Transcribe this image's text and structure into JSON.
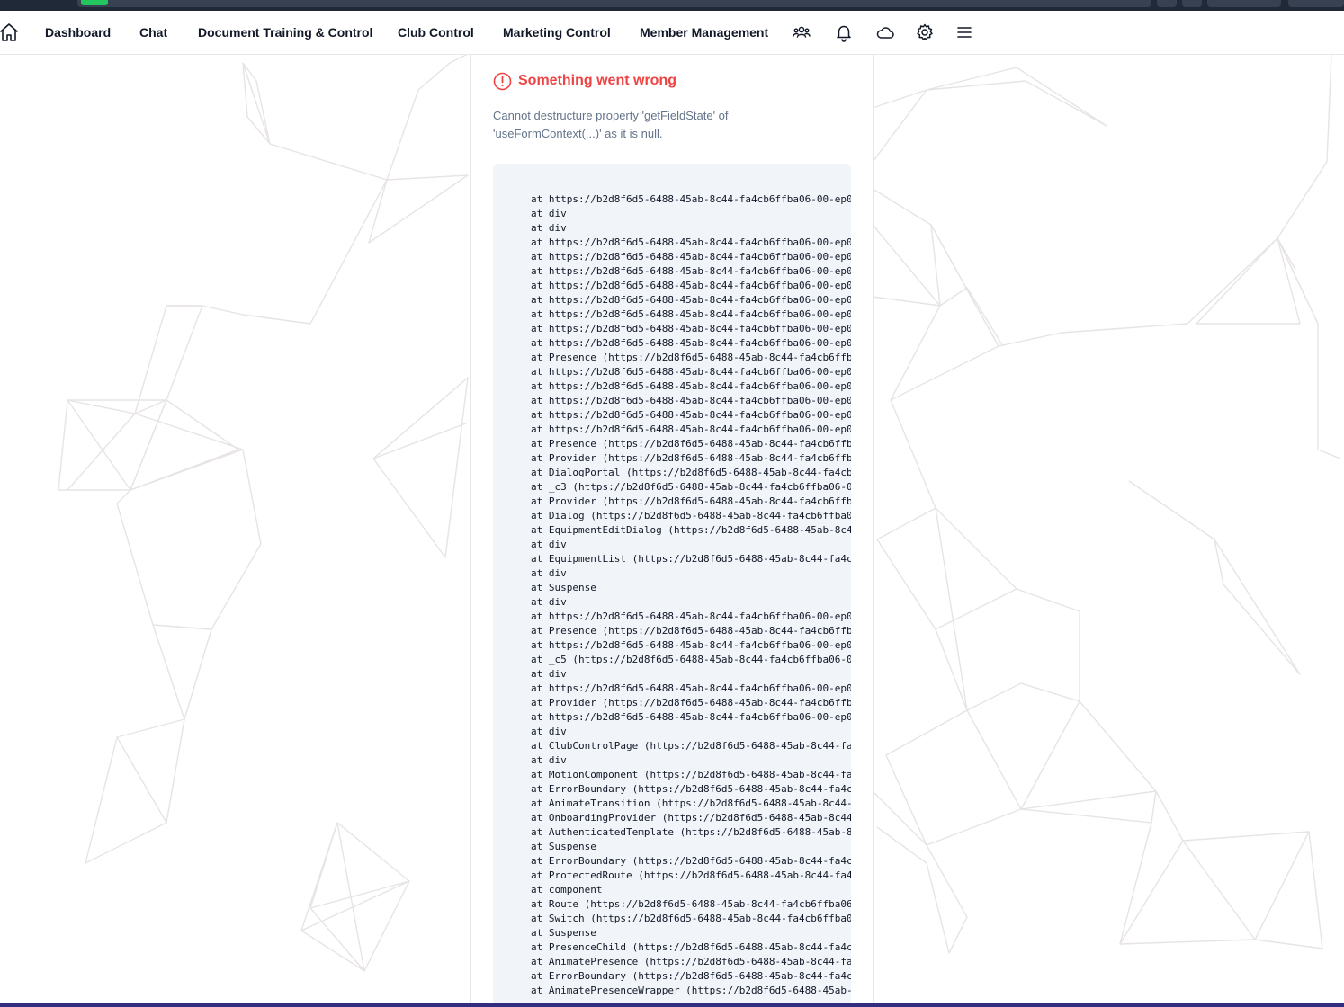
{
  "nav": {
    "links": [
      "Dashboard",
      "Chat",
      "Document Training & Control",
      "Club Control",
      "Marketing Control",
      "Member Management"
    ],
    "icons": [
      "home-icon",
      "users-icon",
      "bell-icon",
      "cloud-icon",
      "gear-icon",
      "menu-icon"
    ]
  },
  "error": {
    "title": "Something went wrong",
    "message": "Cannot destructure property 'getFieldState' of 'useFormContext(...)' as it is null.",
    "stack": [
      "at https://b2d8f6d5-6488-45ab-8c44-fa4cb6ffba06-00-ep0",
      "at div",
      "at div",
      "at https://b2d8f6d5-6488-45ab-8c44-fa4cb6ffba06-00-ep0",
      "at https://b2d8f6d5-6488-45ab-8c44-fa4cb6ffba06-00-ep0",
      "at https://b2d8f6d5-6488-45ab-8c44-fa4cb6ffba06-00-ep0",
      "at https://b2d8f6d5-6488-45ab-8c44-fa4cb6ffba06-00-ep0",
      "at https://b2d8f6d5-6488-45ab-8c44-fa4cb6ffba06-00-ep0",
      "at https://b2d8f6d5-6488-45ab-8c44-fa4cb6ffba06-00-ep0",
      "at https://b2d8f6d5-6488-45ab-8c44-fa4cb6ffba06-00-ep0",
      "at https://b2d8f6d5-6488-45ab-8c44-fa4cb6ffba06-00-ep0",
      "at Presence (https://b2d8f6d5-6488-45ab-8c44-fa4cb6ffb",
      "at https://b2d8f6d5-6488-45ab-8c44-fa4cb6ffba06-00-ep0",
      "at https://b2d8f6d5-6488-45ab-8c44-fa4cb6ffba06-00-ep0",
      "at https://b2d8f6d5-6488-45ab-8c44-fa4cb6ffba06-00-ep0",
      "at https://b2d8f6d5-6488-45ab-8c44-fa4cb6ffba06-00-ep0",
      "at https://b2d8f6d5-6488-45ab-8c44-fa4cb6ffba06-00-ep0",
      "at Presence (https://b2d8f6d5-6488-45ab-8c44-fa4cb6ffb",
      "at Provider (https://b2d8f6d5-6488-45ab-8c44-fa4cb6ffb",
      "at DialogPortal (https://b2d8f6d5-6488-45ab-8c44-fa4cb",
      "at _c3 (https://b2d8f6d5-6488-45ab-8c44-fa4cb6ffba06-0",
      "at Provider (https://b2d8f6d5-6488-45ab-8c44-fa4cb6ffb",
      "at Dialog (https://b2d8f6d5-6488-45ab-8c44-fa4cb6ffba0",
      "at EquipmentEditDialog (https://b2d8f6d5-6488-45ab-8c4",
      "at div",
      "at EquipmentList (https://b2d8f6d5-6488-45ab-8c44-fa4c",
      "at div",
      "at Suspense",
      "at div",
      "at https://b2d8f6d5-6488-45ab-8c44-fa4cb6ffba06-00-ep0",
      "at Presence (https://b2d8f6d5-6488-45ab-8c44-fa4cb6ffb",
      "at https://b2d8f6d5-6488-45ab-8c44-fa4cb6ffba06-00-ep0",
      "at _c5 (https://b2d8f6d5-6488-45ab-8c44-fa4cb6ffba06-0",
      "at div",
      "at https://b2d8f6d5-6488-45ab-8c44-fa4cb6ffba06-00-ep0",
      "at Provider (https://b2d8f6d5-6488-45ab-8c44-fa4cb6ffb",
      "at https://b2d8f6d5-6488-45ab-8c44-fa4cb6ffba06-00-ep0",
      "at div",
      "at ClubControlPage (https://b2d8f6d5-6488-45ab-8c44-fa",
      "at div",
      "at MotionComponent (https://b2d8f6d5-6488-45ab-8c44-fa",
      "at ErrorBoundary (https://b2d8f6d5-6488-45ab-8c44-fa4c",
      "at AnimateTransition (https://b2d8f6d5-6488-45ab-8c44-",
      "at OnboardingProvider (https://b2d8f6d5-6488-45ab-8c44",
      "at AuthenticatedTemplate (https://b2d8f6d5-6488-45ab-8",
      "at Suspense",
      "at ErrorBoundary (https://b2d8f6d5-6488-45ab-8c44-fa4c",
      "at ProtectedRoute (https://b2d8f6d5-6488-45ab-8c44-fa4",
      "at component",
      "at Route (https://b2d8f6d5-6488-45ab-8c44-fa4cb6ffba06",
      "at Switch (https://b2d8f6d5-6488-45ab-8c44-fa4cb6ffba0",
      "at Suspense",
      "at PresenceChild (https://b2d8f6d5-6488-45ab-8c44-fa4c",
      "at AnimatePresence (https://b2d8f6d5-6488-45ab-8c44-fa",
      "at ErrorBoundary (https://b2d8f6d5-6488-45ab-8c44-fa4c",
      "at AnimatePresenceWrapper (https://b2d8f6d5-6488-45ab-"
    ]
  },
  "colors": {
    "error": "#ef4444",
    "message": "#64748b",
    "trace_bg": "#f1f5f9",
    "mesh": "#e7e3e6"
  }
}
